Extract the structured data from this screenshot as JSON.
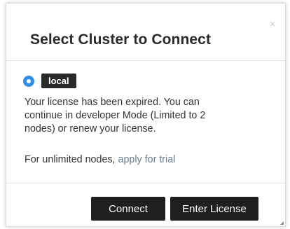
{
  "dialog": {
    "title": "Select Cluster to Connect",
    "close_glyph": "×",
    "cluster": {
      "name": "local",
      "selected": true
    },
    "license_message": "Your license has been expired. You can continue in developer Mode (Limited to 2 nodes) or renew your license.",
    "trial_prefix": "For unlimited nodes, ",
    "trial_link": "apply for trial",
    "buttons": {
      "connect": "Connect",
      "enter_license": "Enter License"
    }
  },
  "colors": {
    "radio_accent": "#2f8fe8",
    "button_bg": "#1f1f1f",
    "link": "#6a7f8f"
  },
  "icons": {
    "close": "close-icon",
    "radio": "radio-selected-icon",
    "resize": "resize-grip-icon"
  }
}
